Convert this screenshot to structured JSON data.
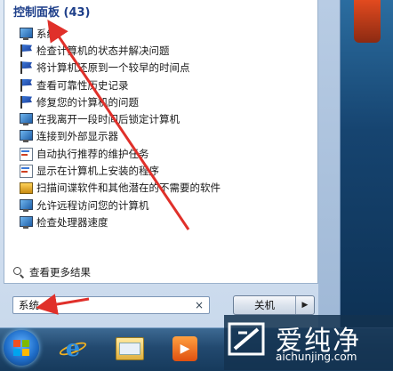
{
  "start_menu": {
    "group_header": "控制面板 (43)",
    "results": [
      {
        "label": "系统",
        "icon": "monitor-icon"
      },
      {
        "label": "检查计算机的状态并解决问题",
        "icon": "flag-icon"
      },
      {
        "label": "将计算机还原到一个较早的时间点",
        "icon": "flag-icon"
      },
      {
        "label": "查看可靠性历史记录",
        "icon": "flag-icon"
      },
      {
        "label": "修复您的计算机的问题",
        "icon": "flag-icon"
      },
      {
        "label": "在我离开一段时间后锁定计算机",
        "icon": "monitor-icon"
      },
      {
        "label": "连接到外部显示器",
        "icon": "monitor-icon"
      },
      {
        "label": "自动执行推荐的维护任务",
        "icon": "task-icon"
      },
      {
        "label": "显示在计算机上安装的程序",
        "icon": "task-icon"
      },
      {
        "label": "扫描间谍软件和其他潜在的不需要的软件",
        "icon": "scan-icon"
      },
      {
        "label": "允许远程访问您的计算机",
        "icon": "monitor-icon"
      },
      {
        "label": "检查处理器速度",
        "icon": "monitor-icon"
      }
    ],
    "see_more": "查看更多结果",
    "search": {
      "value": "系统",
      "clear_glyph": "×"
    },
    "shutdown": {
      "label": "关机",
      "arrow": "▶"
    }
  },
  "taskbar": {
    "items": [
      "start-orb",
      "internet-explorer",
      "windows-explorer",
      "media-player"
    ]
  },
  "watermark": {
    "title": "爱纯净",
    "url": "aichunjing.com"
  },
  "colors": {
    "header_text": "#1e3f8a",
    "annotation_arrow": "#e0302a",
    "taskbar_top": "#3d6a93"
  }
}
